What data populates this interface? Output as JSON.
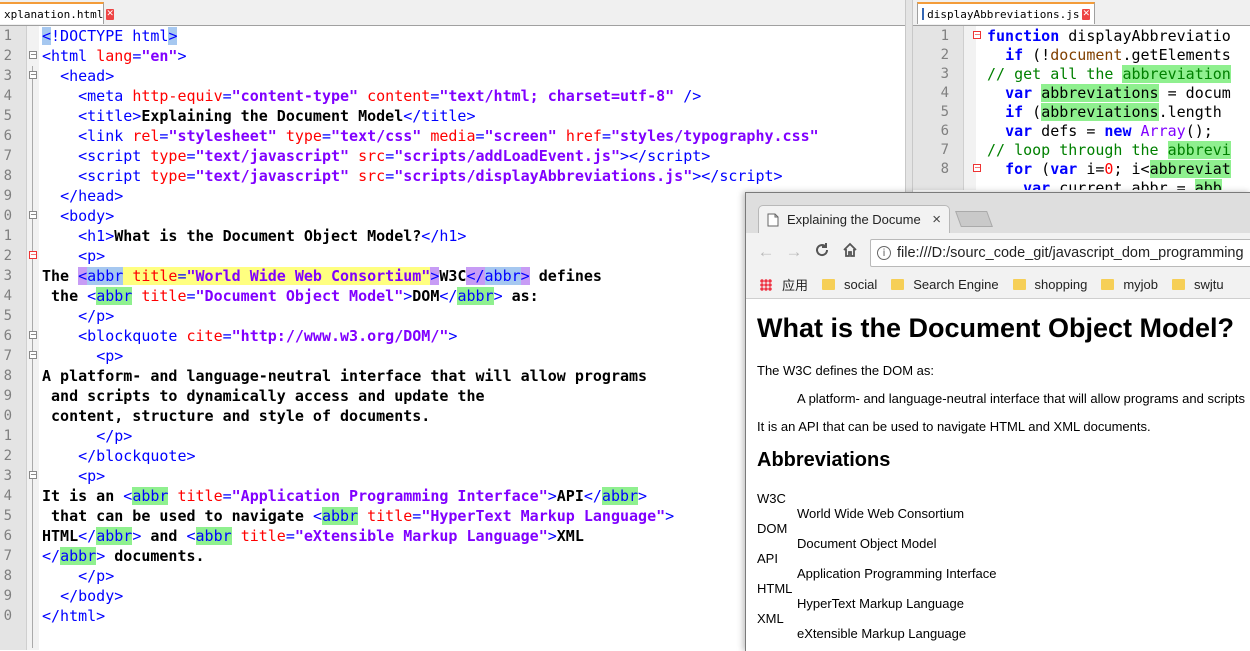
{
  "left_editor": {
    "tab_name": "xplanation.html",
    "lines": [
      {
        "n": "1"
      },
      {
        "n": "2"
      },
      {
        "n": "3"
      },
      {
        "n": "4"
      },
      {
        "n": "5"
      },
      {
        "n": "6"
      },
      {
        "n": "7"
      },
      {
        "n": "8"
      },
      {
        "n": "9"
      },
      {
        "n": "0"
      },
      {
        "n": "1"
      },
      {
        "n": "2"
      },
      {
        "n": "3"
      },
      {
        "n": "4"
      },
      {
        "n": "5"
      },
      {
        "n": "6"
      },
      {
        "n": "7"
      },
      {
        "n": "8"
      },
      {
        "n": "9"
      },
      {
        "n": "0"
      },
      {
        "n": "1"
      },
      {
        "n": "2"
      },
      {
        "n": "3"
      },
      {
        "n": "4"
      },
      {
        "n": "5"
      },
      {
        "n": "6"
      },
      {
        "n": "7"
      },
      {
        "n": "8"
      },
      {
        "n": "9"
      },
      {
        "n": "0"
      }
    ]
  },
  "right_editor": {
    "tab_name": "displayAbbreviations.js",
    "lines": [
      {
        "n": "1"
      },
      {
        "n": "2"
      },
      {
        "n": "3"
      },
      {
        "n": "4"
      },
      {
        "n": "5"
      },
      {
        "n": "6"
      },
      {
        "n": "7"
      },
      {
        "n": "8"
      }
    ]
  },
  "browser": {
    "tab_title": "Explaining the Docume",
    "tab_close": "×",
    "url": "file:///D:/sourc_code_git/javascript_dom_programming",
    "bookmarks": [
      {
        "label": "应用"
      },
      {
        "label": "social"
      },
      {
        "label": "Search Engine"
      },
      {
        "label": "shopping"
      },
      {
        "label": "myjob"
      },
      {
        "label": "swjtu"
      }
    ],
    "page": {
      "h1": "What is the Document Object Model?",
      "p1": "The W3C defines the DOM as:",
      "quote": "A platform- and language-neutral interface that will allow programs and scripts",
      "p2": "It is an API that can be used to navigate HTML and XML documents.",
      "h2": "Abbreviations",
      "abbreviations": [
        {
          "term": "W3C",
          "def": "World Wide Web Consortium"
        },
        {
          "term": "DOM",
          "def": "Document Object Model"
        },
        {
          "term": "API",
          "def": "Application Programming Interface"
        },
        {
          "term": "HTML",
          "def": "HyperText Markup Language"
        },
        {
          "term": "XML",
          "def": "eXtensible Markup Language"
        }
      ]
    }
  },
  "colors": {
    "tag": "#0000ff",
    "attr": "#ff0000",
    "value": "#8000ff",
    "comment": "#008000",
    "tab_accent": "#f39c3a"
  }
}
